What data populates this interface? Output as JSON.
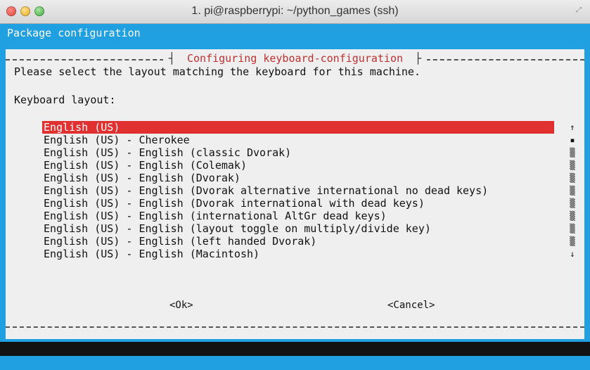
{
  "window": {
    "title": "1. pi@raspberrypi: ~/python_games (ssh)",
    "buttons": [
      "close",
      "minimize",
      "zoom"
    ],
    "resize_icon": "fullscreen-icon"
  },
  "terminal": {
    "header": "Package configuration",
    "background_color": "#20a0e0"
  },
  "dialog": {
    "title": "Configuring keyboard-configuration",
    "prompt": "Please select the layout matching the keyboard for this machine.",
    "list_label": "Keyboard layout:",
    "selected_index": 0,
    "selected_color": "#e03030",
    "items": [
      "English (US)",
      "English (US) - Cherokee",
      "English (US) - English (classic Dvorak)",
      "English (US) - English (Colemak)",
      "English (US) - English (Dvorak)",
      "English (US) - English (Dvorak alternative international no dead keys)",
      "English (US) - English (Dvorak international with dead keys)",
      "English (US) - English (international AltGr dead keys)",
      "English (US) - English (layout toggle on multiply/divide key)",
      "English (US) - English (left handed Dvorak)",
      "English (US) - English (Macintosh)"
    ],
    "scrollbar": [
      "↑",
      "▪",
      "▒",
      "▒",
      "▒",
      "▒",
      "▒",
      "▒",
      "▒",
      "▒",
      "↓"
    ],
    "ok_label": "<Ok>",
    "cancel_label": "<Cancel>"
  }
}
